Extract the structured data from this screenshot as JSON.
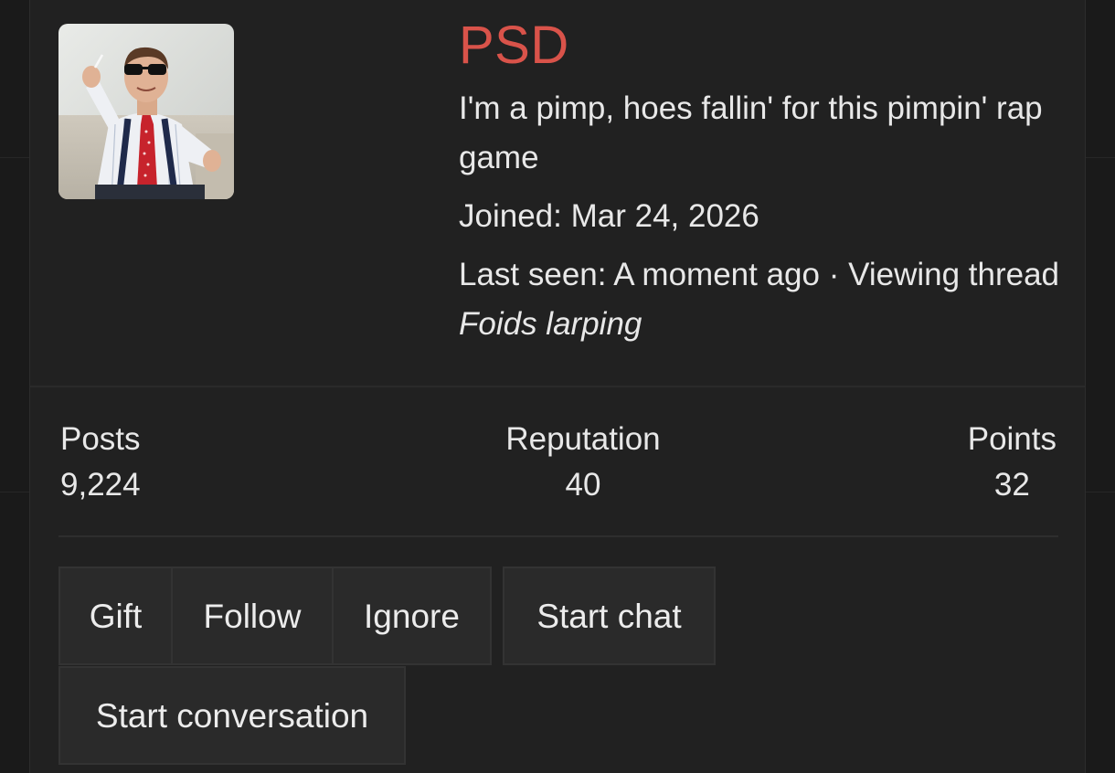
{
  "profile": {
    "username": "PSD",
    "bio": "I'm a pimp, hoes fallin' for this pimpin' rap game",
    "joined_label": "Joined:",
    "joined_date": "Mar 24, 2026",
    "last_seen_label": "Last seen:",
    "last_seen_value": "A moment ago",
    "separator": "·",
    "activity_prefix": "Viewing thread",
    "activity_thread": "Foids larping",
    "name_color": "#d9534a"
  },
  "stats": {
    "posts_label": "Posts",
    "posts_value": "9,224",
    "reputation_label": "Reputation",
    "reputation_value": "40",
    "points_label": "Points",
    "points_value": "32"
  },
  "actions": {
    "gift": "Gift",
    "follow": "Follow",
    "ignore": "Ignore",
    "start_chat": "Start chat",
    "start_conversation": "Start conversation"
  }
}
